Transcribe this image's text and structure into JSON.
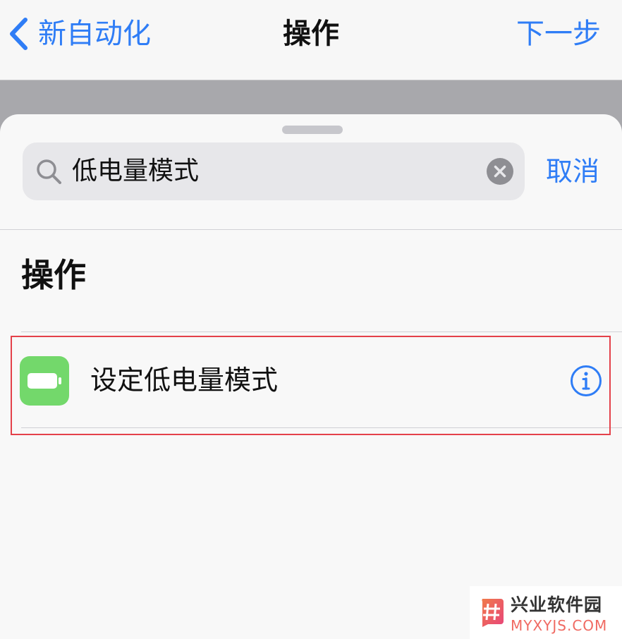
{
  "navbar": {
    "back_label": "新自动化",
    "title": "操作",
    "next_label": "下一步"
  },
  "search": {
    "value": "低电量模式",
    "cancel_label": "取消"
  },
  "section": {
    "title": "操作"
  },
  "actions": [
    {
      "label": "设定低电量模式",
      "icon": "battery-icon",
      "icon_color": "#73d86b"
    }
  ],
  "watermark": {
    "title": "兴业软件园",
    "url": "MYXYJS.COM"
  },
  "colors": {
    "accent": "#2f7df6",
    "highlight": "#e4414a"
  }
}
